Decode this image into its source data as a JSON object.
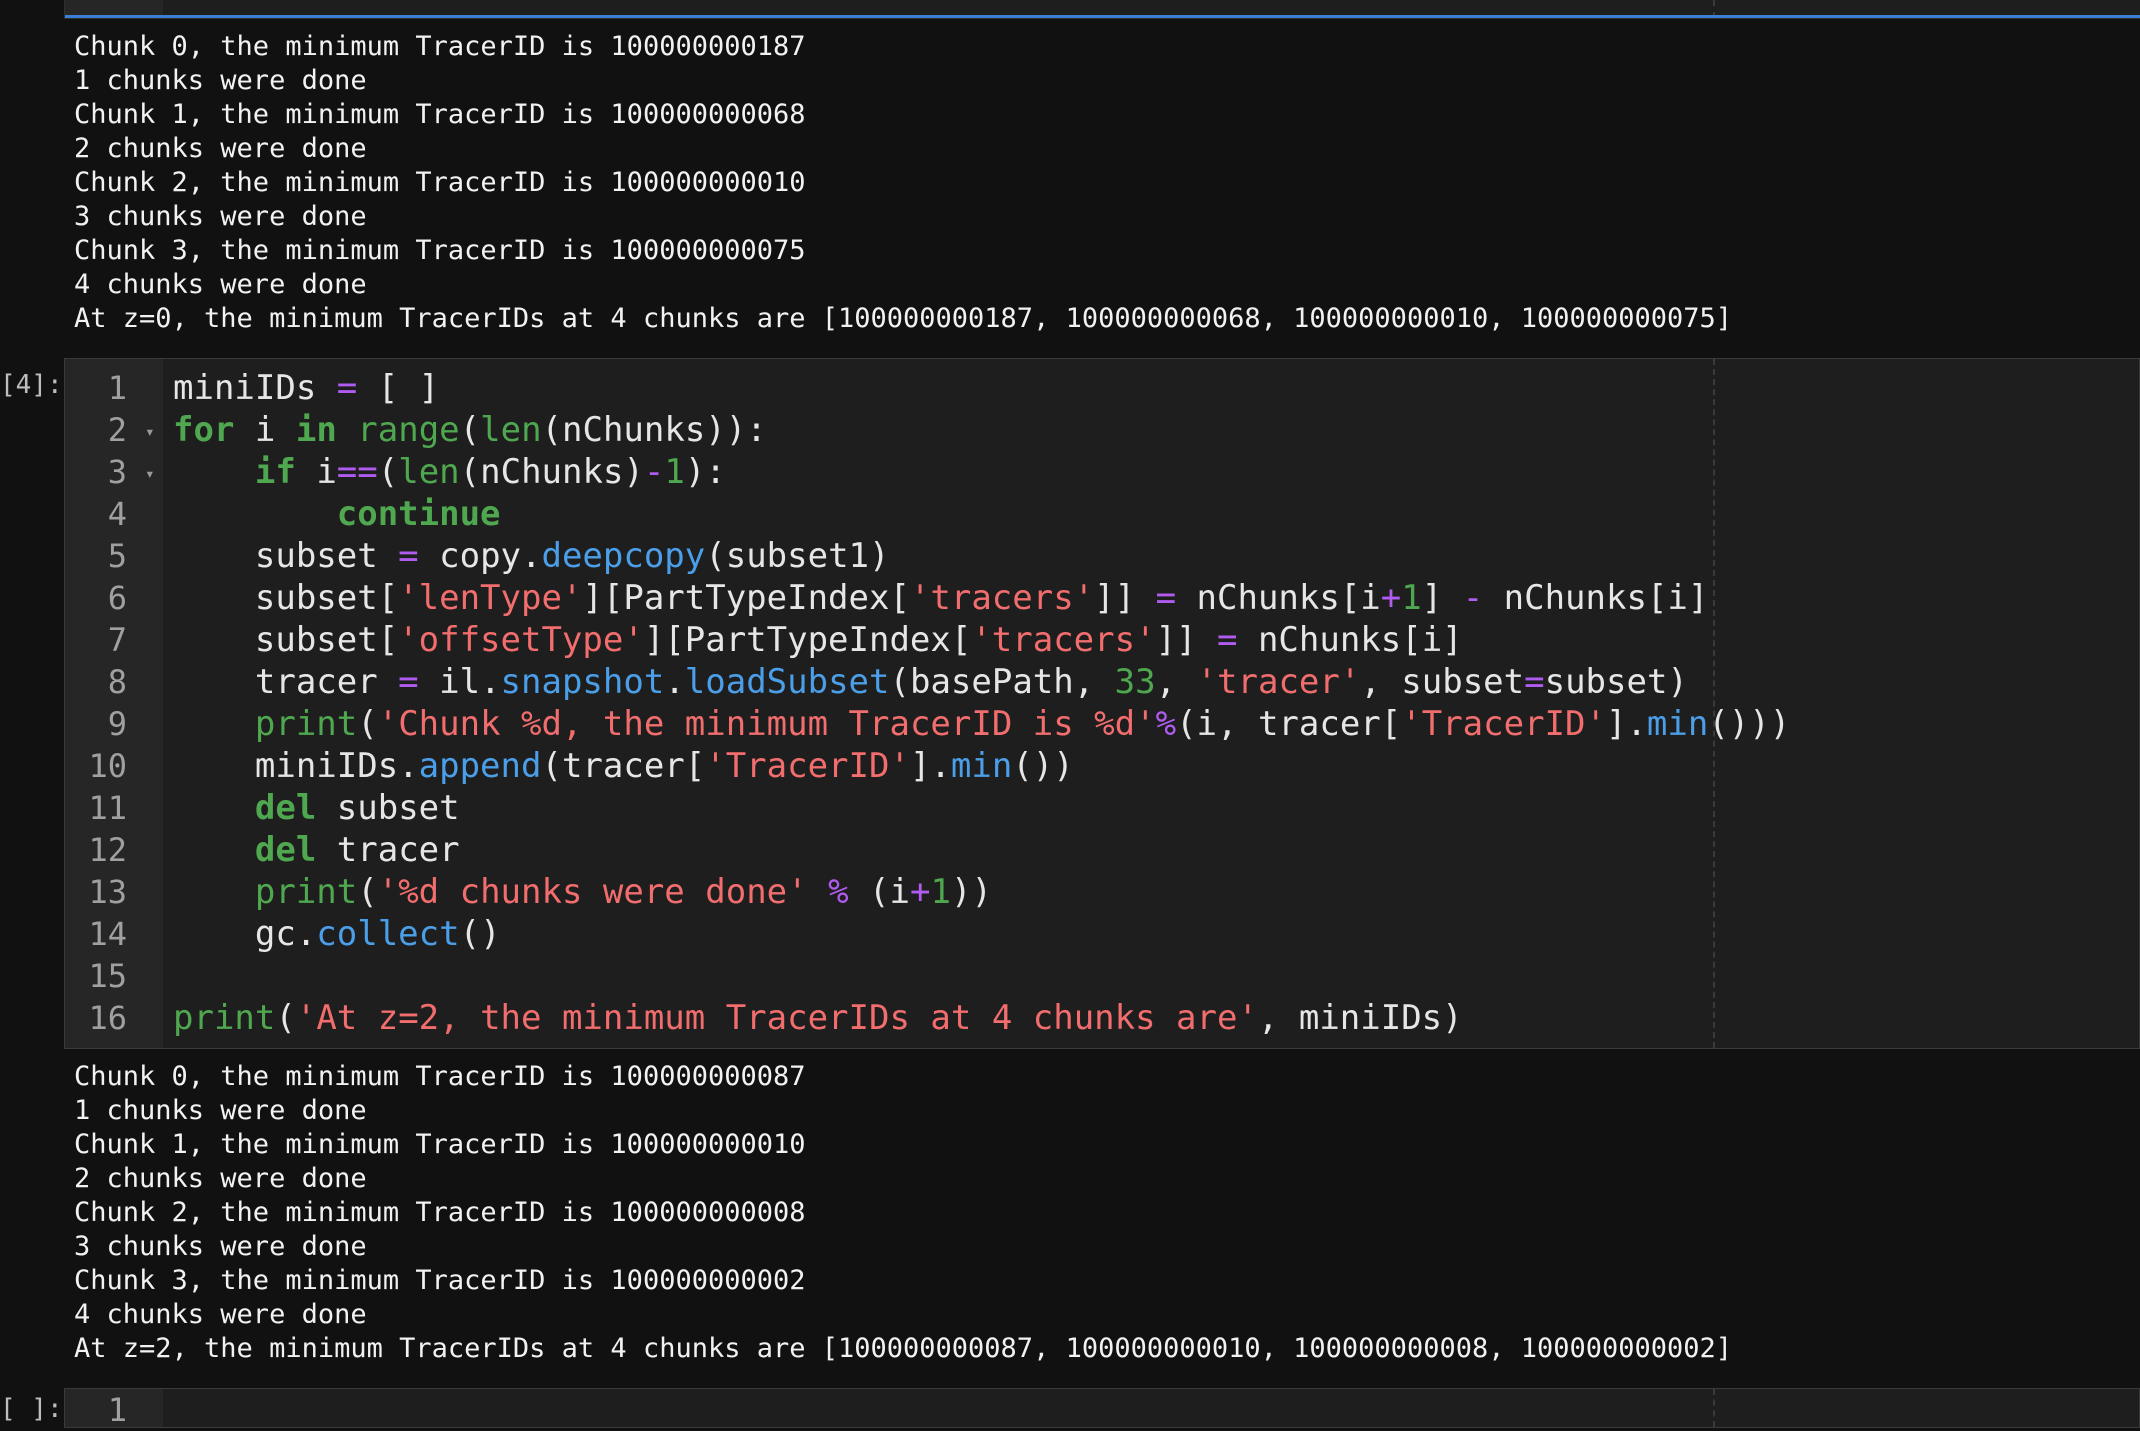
{
  "top_output": [
    "Chunk 0, the minimum TracerID is 100000000187",
    "1 chunks were done",
    "Chunk 1, the minimum TracerID is 100000000068",
    "2 chunks were done",
    "Chunk 2, the minimum TracerID is 100000000010",
    "3 chunks were done",
    "Chunk 3, the minimum TracerID is 100000000075",
    "4 chunks were done",
    "At z=0, the minimum TracerIDs at 4 chunks are [100000000187, 100000000068, 100000000010, 100000000075]"
  ],
  "cell4": {
    "prompt": "[4]:",
    "lines": [
      {
        "n": "1",
        "fold": false,
        "tokens": [
          [
            "plain",
            "miniIDs "
          ],
          [
            "op",
            "="
          ],
          [
            "plain",
            " [ ]"
          ]
        ]
      },
      {
        "n": "2",
        "fold": true,
        "tokens": [
          [
            "kw",
            "for"
          ],
          [
            "plain",
            " i "
          ],
          [
            "kw",
            "in"
          ],
          [
            "plain",
            " "
          ],
          [
            "bi",
            "range"
          ],
          [
            "plain",
            "("
          ],
          [
            "bi",
            "len"
          ],
          [
            "plain",
            "(nChunks)):"
          ]
        ]
      },
      {
        "n": "3",
        "fold": true,
        "tokens": [
          [
            "plain",
            "    "
          ],
          [
            "kw",
            "if"
          ],
          [
            "plain",
            " i"
          ],
          [
            "op",
            "=="
          ],
          [
            "plain",
            "("
          ],
          [
            "bi",
            "len"
          ],
          [
            "plain",
            "(nChunks)"
          ],
          [
            "op",
            "-"
          ],
          [
            "num",
            "1"
          ],
          [
            "plain",
            "):"
          ]
        ]
      },
      {
        "n": "4",
        "fold": false,
        "tokens": [
          [
            "plain",
            "        "
          ],
          [
            "kw",
            "continue"
          ]
        ]
      },
      {
        "n": "5",
        "fold": false,
        "tokens": [
          [
            "plain",
            "    subset "
          ],
          [
            "op",
            "="
          ],
          [
            "plain",
            " copy."
          ],
          [
            "meth",
            "deepcopy"
          ],
          [
            "plain",
            "(subset1)"
          ]
        ]
      },
      {
        "n": "6",
        "fold": false,
        "tokens": [
          [
            "plain",
            "    subset["
          ],
          [
            "str",
            "'lenType'"
          ],
          [
            "plain",
            "][PartTypeIndex["
          ],
          [
            "str",
            "'tracers'"
          ],
          [
            "plain",
            "]] "
          ],
          [
            "op",
            "="
          ],
          [
            "plain",
            " nChunks[i"
          ],
          [
            "op",
            "+"
          ],
          [
            "num",
            "1"
          ],
          [
            "plain",
            "] "
          ],
          [
            "op",
            "-"
          ],
          [
            "plain",
            " nChunks[i]"
          ]
        ]
      },
      {
        "n": "7",
        "fold": false,
        "tokens": [
          [
            "plain",
            "    subset["
          ],
          [
            "str",
            "'offsetType'"
          ],
          [
            "plain",
            "][PartTypeIndex["
          ],
          [
            "str",
            "'tracers'"
          ],
          [
            "plain",
            "]] "
          ],
          [
            "op",
            "="
          ],
          [
            "plain",
            " nChunks[i]"
          ]
        ]
      },
      {
        "n": "8",
        "fold": false,
        "tokens": [
          [
            "plain",
            "    tracer "
          ],
          [
            "op",
            "="
          ],
          [
            "plain",
            " il."
          ],
          [
            "meth",
            "snapshot"
          ],
          [
            "plain",
            "."
          ],
          [
            "meth",
            "loadSubset"
          ],
          [
            "plain",
            "(basePath, "
          ],
          [
            "num",
            "33"
          ],
          [
            "plain",
            ", "
          ],
          [
            "str",
            "'tracer'"
          ],
          [
            "plain",
            ", subset"
          ],
          [
            "op",
            "="
          ],
          [
            "plain",
            "subset)"
          ]
        ]
      },
      {
        "n": "9",
        "fold": false,
        "tokens": [
          [
            "plain",
            "    "
          ],
          [
            "bi",
            "print"
          ],
          [
            "plain",
            "("
          ],
          [
            "str",
            "'Chunk %d, the minimum TracerID is %d'"
          ],
          [
            "op",
            "%"
          ],
          [
            "plain",
            "(i, tracer["
          ],
          [
            "str",
            "'TracerID'"
          ],
          [
            "plain",
            "]."
          ],
          [
            "meth",
            "min"
          ],
          [
            "plain",
            "()))"
          ]
        ]
      },
      {
        "n": "10",
        "fold": false,
        "tokens": [
          [
            "plain",
            "    miniIDs."
          ],
          [
            "meth",
            "append"
          ],
          [
            "plain",
            "(tracer["
          ],
          [
            "str",
            "'TracerID'"
          ],
          [
            "plain",
            "]."
          ],
          [
            "meth",
            "min"
          ],
          [
            "plain",
            "())"
          ]
        ]
      },
      {
        "n": "11",
        "fold": false,
        "tokens": [
          [
            "plain",
            "    "
          ],
          [
            "kw",
            "del"
          ],
          [
            "plain",
            " subset"
          ]
        ]
      },
      {
        "n": "12",
        "fold": false,
        "tokens": [
          [
            "plain",
            "    "
          ],
          [
            "kw",
            "del"
          ],
          [
            "plain",
            " tracer"
          ]
        ]
      },
      {
        "n": "13",
        "fold": false,
        "tokens": [
          [
            "plain",
            "    "
          ],
          [
            "bi",
            "print"
          ],
          [
            "plain",
            "("
          ],
          [
            "str",
            "'%d chunks were done'"
          ],
          [
            "plain",
            " "
          ],
          [
            "op",
            "%"
          ],
          [
            "plain",
            " (i"
          ],
          [
            "op",
            "+"
          ],
          [
            "num",
            "1"
          ],
          [
            "plain",
            "))"
          ]
        ]
      },
      {
        "n": "14",
        "fold": false,
        "tokens": [
          [
            "plain",
            "    gc."
          ],
          [
            "meth",
            "collect"
          ],
          [
            "plain",
            "()"
          ]
        ]
      },
      {
        "n": "15",
        "fold": false,
        "tokens": []
      },
      {
        "n": "16",
        "fold": false,
        "tokens": [
          [
            "bi",
            "print"
          ],
          [
            "plain",
            "("
          ],
          [
            "str",
            "'At z=2, the minimum TracerIDs at 4 chunks are'"
          ],
          [
            "plain",
            ", miniIDs)"
          ]
        ]
      }
    ]
  },
  "cell4_output": [
    "Chunk 0, the minimum TracerID is 100000000087",
    "1 chunks were done",
    "Chunk 1, the minimum TracerID is 100000000010",
    "2 chunks were done",
    "Chunk 2, the minimum TracerID is 100000000008",
    "3 chunks were done",
    "Chunk 3, the minimum TracerID is 100000000002",
    "4 chunks were done",
    "At z=2, the minimum TracerIDs at 4 chunks are [100000000087, 100000000010, 100000000008, 100000000002]"
  ],
  "next_cell": {
    "prompt": "[ ]:",
    "first_line_number": "1"
  },
  "colors": {
    "keyword": "#4fa84f",
    "operator": "#b05cf0",
    "string": "#f26d6d",
    "method": "#4b9ee8",
    "active_cell_border": "#3a7fd5"
  },
  "icons": {
    "fold": "chevron-down-icon"
  }
}
